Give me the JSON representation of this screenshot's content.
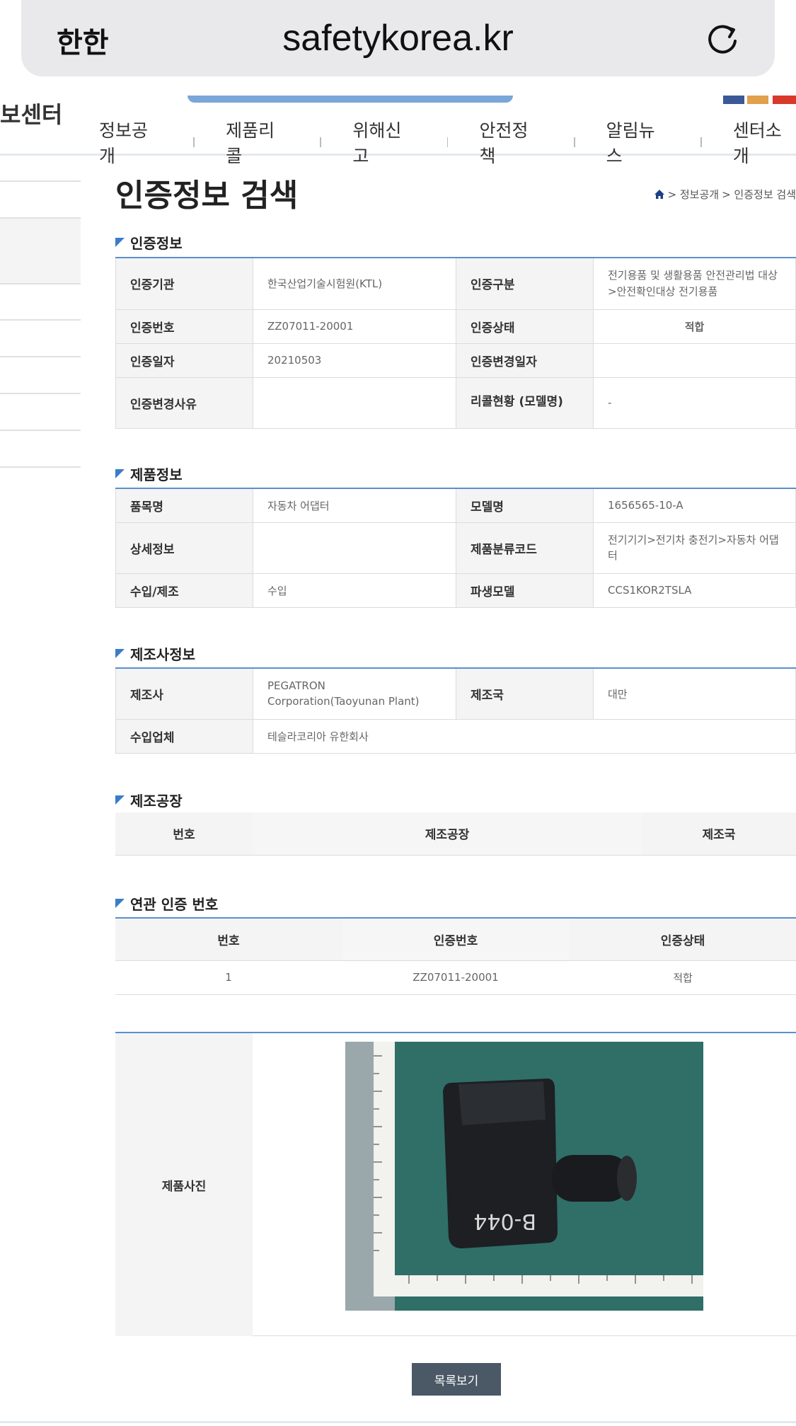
{
  "browser": {
    "aa_label": "한한",
    "url": "safetykorea.kr"
  },
  "header": {
    "logo_partial": "보센터",
    "nav": [
      "정보공개",
      "제품리콜",
      "위해신고",
      "안전정책",
      "알림뉴스",
      "센터소개"
    ]
  },
  "page": {
    "title": "인증정보 검색",
    "breadcrumb": [
      "> 정보공개",
      "> 인증정보 검색"
    ]
  },
  "cert_info": {
    "section_title": "인증정보",
    "rows": [
      {
        "k1": "인증기관",
        "v1": "한국산업기술시험원(KTL)",
        "k2": "인증구분",
        "v2": "전기용품 및 생활용품 안전관리법 대상 >안전확인대상 전기용품"
      },
      {
        "k1": "인증번호",
        "v1": "ZZ07011-20001",
        "k2": "인증상태",
        "v2": "적합"
      },
      {
        "k1": "인증일자",
        "v1": "20210503",
        "k2": "인증변경일자",
        "v2": ""
      },
      {
        "k1": "인증변경사유",
        "v1": "",
        "k2": "리콜현황 (모델명)",
        "v2": "-"
      }
    ]
  },
  "product_info": {
    "section_title": "제품정보",
    "rows": [
      {
        "k1": "품목명",
        "v1": "자동차 어댑터",
        "k2": "모델명",
        "v2": "1656565-10-A"
      },
      {
        "k1": "상세정보",
        "v1": "",
        "k2": "제품분류코드",
        "v2": "전기기기>전기차 충전기>자동차 어댑터"
      },
      {
        "k1": "수입/제조",
        "v1": "수입",
        "k2": "파생모델",
        "v2": "CCS1KOR2TSLA"
      }
    ]
  },
  "maker_info": {
    "section_title": "제조사정보",
    "maker_label": "제조사",
    "maker_value": "PEGATRON Corporation(Taoyunan Plant)",
    "country_label": "제조국",
    "country_value": "대만",
    "importer_label": "수입업체",
    "importer_value": "테슬라코리아 유한회사"
  },
  "factory": {
    "section_title": "제조공장",
    "headers": [
      "번호",
      "제조공장",
      "제조국"
    ]
  },
  "related": {
    "section_title": "연관 인증 번호",
    "headers": [
      "번호",
      "인증번호",
      "인증상태"
    ],
    "rows": [
      {
        "no": "1",
        "cert_no": "ZZ07011-20001",
        "status": "적합"
      }
    ]
  },
  "photo": {
    "label": "제품사진",
    "marking": "B-044"
  },
  "actions": {
    "list_button": "목록보기"
  },
  "colors": {
    "accent": "#3a7cc9",
    "table_border": "#5a8fcf",
    "button": "#4b5866",
    "status": "#1a3e9e"
  }
}
